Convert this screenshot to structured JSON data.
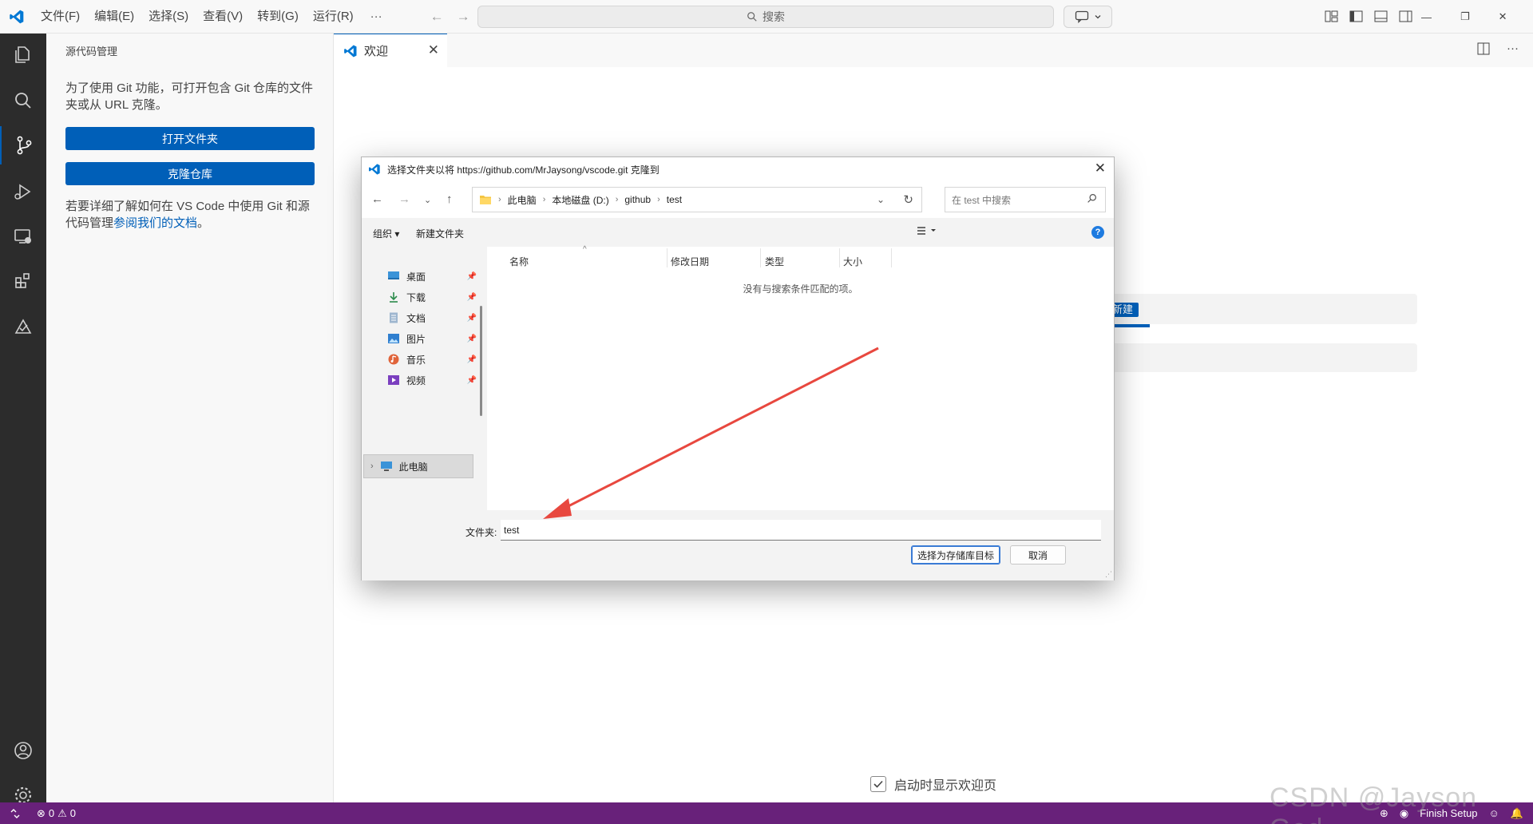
{
  "titlebar": {
    "menu": [
      "文件(F)",
      "编辑(E)",
      "选择(S)",
      "查看(V)",
      "转到(G)",
      "运行(R)"
    ],
    "more": "···",
    "search_placeholder": "搜索"
  },
  "activitybar": {
    "icons": [
      "explorer-icon",
      "search-icon",
      "source-control-icon",
      "run-debug-icon",
      "remote-explorer-icon",
      "extensions-icon",
      "testing-icon",
      "account-icon",
      "settings-gear-icon"
    ],
    "active": "source-control-icon"
  },
  "sidebar": {
    "title": "源代码管理",
    "intro": "为了使用 Git 功能，可打开包含 Git 仓库的文件夹或从 URL 克隆。",
    "open_folder_btn": "打开文件夹",
    "clone_btn": "克隆仓库",
    "learn_prefix": "若要详细了解如何在 VS Code 中使用 Git 和源代码管理",
    "learn_link": "参阅我们的文档",
    "learn_suffix": "。"
  },
  "editor": {
    "tab_label": "欢迎",
    "new_chip": "新建",
    "show_welcome_label": "启动时显示欢迎页",
    "show_welcome_checked": true
  },
  "dialog": {
    "title": "选择文件夹以将 https://github.com/MrJaysong/vscode.git 克隆到",
    "breadcrumb": [
      "此电脑",
      "本地磁盘 (D:)",
      "github",
      "test"
    ],
    "search_placeholder": "在 test 中搜索",
    "toolbar_organize": "组织 ▾",
    "toolbar_new_folder": "新建文件夹",
    "nav_items": [
      {
        "label": "桌面",
        "icon": "desktop-icon"
      },
      {
        "label": "下载",
        "icon": "download-icon"
      },
      {
        "label": "文档",
        "icon": "documents-icon"
      },
      {
        "label": "图片",
        "icon": "pictures-icon"
      },
      {
        "label": "音乐",
        "icon": "music-icon"
      },
      {
        "label": "视频",
        "icon": "videos-icon"
      }
    ],
    "this_pc": "此电脑",
    "columns": [
      "名称",
      "修改日期",
      "类型",
      "大小"
    ],
    "empty_message": "没有与搜索条件匹配的项。",
    "folder_label": "文件夹:",
    "folder_value": "test",
    "confirm_btn": "选择为存储库目标",
    "cancel_btn": "取消"
  },
  "statusbar": {
    "errors": "0",
    "warnings": "0",
    "finish_setup": "Finish Setup"
  },
  "watermark": "CSDN @Jayson God",
  "colors": {
    "accent": "#005fb8",
    "statusbar": "#68217a",
    "arrow": "#e8483f"
  }
}
